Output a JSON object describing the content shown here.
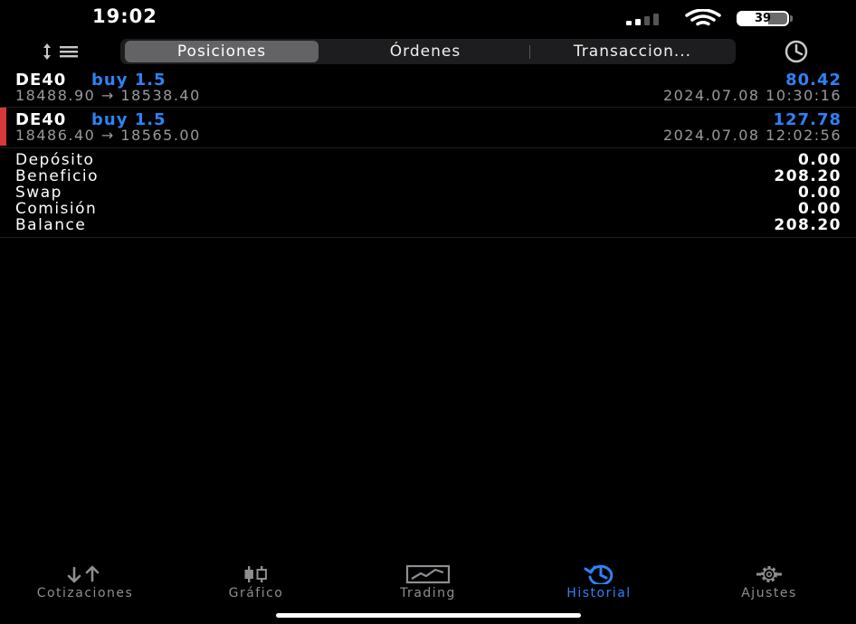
{
  "status_bar": {
    "time": "19:02",
    "battery": "39"
  },
  "segments": [
    "Posiciones",
    "Órdenes",
    "Transaccion..."
  ],
  "positions": [
    {
      "symbol": "DE40",
      "side": "buy 1.5",
      "profit": "80.42",
      "prices": "18488.90 → 18538.40",
      "datetime": "2024.07.08 10:30:16"
    },
    {
      "symbol": "DE40",
      "side": "buy 1.5",
      "profit": "127.78",
      "prices": "18486.40 → 18565.00",
      "datetime": "2024.07.08 12:02:56"
    }
  ],
  "summary": [
    {
      "label": "Depósito",
      "value": "0.00"
    },
    {
      "label": "Beneficio",
      "value": "208.20"
    },
    {
      "label": "Swap",
      "value": "0.00"
    },
    {
      "label": "Comisión",
      "value": "0.00"
    },
    {
      "label": "Balance",
      "value": "208.20"
    }
  ],
  "tabs": [
    {
      "label": "Cotizaciones",
      "icon": "quotes-icon"
    },
    {
      "label": "Gráfico",
      "icon": "chart-icon"
    },
    {
      "label": "Trading",
      "icon": "trading-icon"
    },
    {
      "label": "Historial",
      "icon": "history-icon",
      "active": true
    },
    {
      "label": "Ajustes",
      "icon": "settings-icon"
    }
  ],
  "colors": {
    "accent": "#2e82f6",
    "position_marker": "#d9383a",
    "muted": "#9a9a9e"
  }
}
